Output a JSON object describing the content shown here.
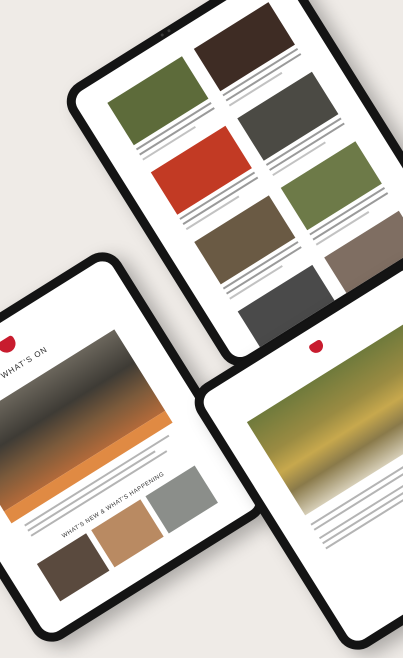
{
  "scene": "three tablets showing newsletter pages",
  "colors": {
    "background": "#efebe7",
    "device": "#141414",
    "brand_red": "#c81c2e",
    "accent_orange": "#e08a43"
  },
  "tablet_whats_on": {
    "logo_text": "",
    "title": "WHAT'S ON",
    "subtitle": "",
    "section_heading": "WHAT'S NEW & WHAT'S HAPPENING"
  },
  "tablet_article": {
    "title": ""
  },
  "tablet_list": {
    "thumb_colors": [
      [
        "#5d6b3a",
        "#3e2c24"
      ],
      [
        "#c23a24",
        "#4b4a44"
      ],
      [
        "#6a5a44",
        "#6d7a48"
      ],
      [
        "#4a4a4a",
        "#7f6e62"
      ],
      [
        "#8a6a4e",
        "#3f5a7a"
      ]
    ]
  }
}
